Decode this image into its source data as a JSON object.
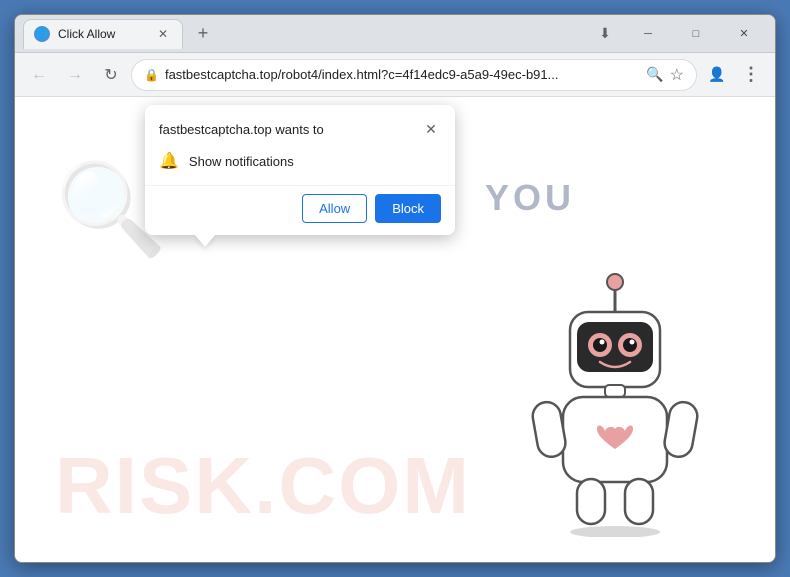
{
  "browser": {
    "title_bar": {
      "tab_title": "Click Allow",
      "tab_favicon": "🌐",
      "new_tab_label": "+",
      "controls": {
        "minimize": "─",
        "maximize": "□",
        "close": "✕"
      }
    },
    "toolbar": {
      "back_icon": "←",
      "forward_icon": "→",
      "refresh_icon": "↻",
      "address": "fastbestcaptcha.top/robot4/index.html?c=4f14edc9-a5a9-49ec-b91...",
      "lock_icon": "🔒",
      "search_icon": "🔍",
      "bookmark_icon": "☆",
      "profile_icon": "👤",
      "menu_icon": "⋮",
      "extensions_icon": "⬇"
    },
    "popup": {
      "title": "fastbestcaptcha.top wants to",
      "close_icon": "✕",
      "notification_label": "Show notifications",
      "bell_icon": "🔔",
      "allow_button": "Allow",
      "block_button": "Block"
    },
    "page": {
      "you_text": "YOU",
      "watermark": "RISK.COM"
    }
  }
}
